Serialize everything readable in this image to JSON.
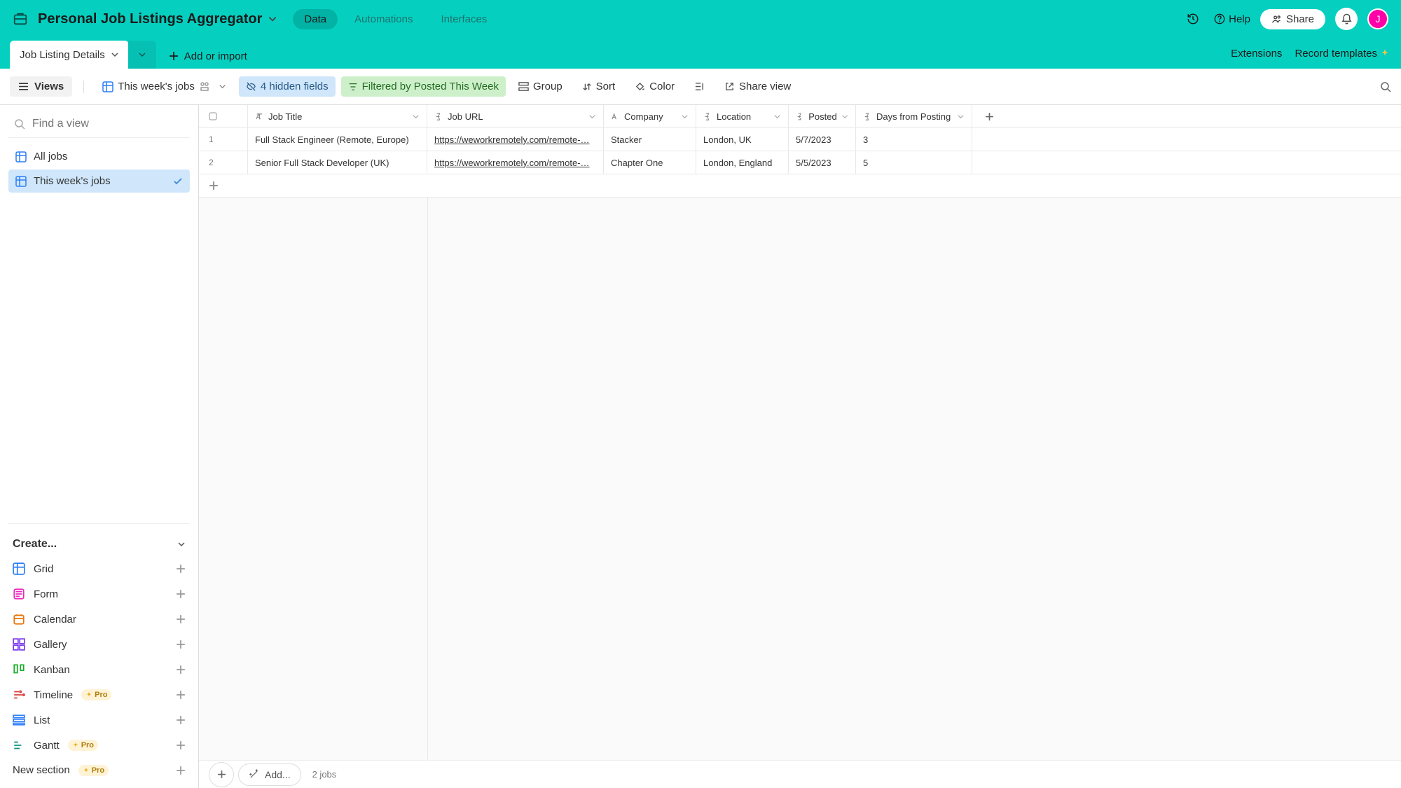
{
  "header": {
    "base_title": "Personal Job Listings Aggregator",
    "nav": {
      "data": "Data",
      "automations": "Automations",
      "interfaces": "Interfaces"
    },
    "help": "Help",
    "share": "Share",
    "avatar_initial": "J"
  },
  "tabbar": {
    "table_name": "Job Listing Details",
    "add_or_import": "Add or import",
    "extensions": "Extensions",
    "record_templates": "Record templates"
  },
  "toolbar": {
    "views": "Views",
    "view_name": "This week's jobs",
    "hidden_fields": "4 hidden fields",
    "filtered_by": "Filtered by Posted This Week",
    "group": "Group",
    "sort": "Sort",
    "color": "Color",
    "share_view": "Share view"
  },
  "sidebar": {
    "search_placeholder": "Find a view",
    "views": [
      {
        "label": "All jobs",
        "active": false
      },
      {
        "label": "This week's jobs",
        "active": true
      }
    ],
    "create_label": "Create...",
    "create_items": [
      {
        "label": "Grid",
        "icon": "grid",
        "color": "ic-blue",
        "pro": false
      },
      {
        "label": "Form",
        "icon": "form",
        "color": "ic-pink",
        "pro": false
      },
      {
        "label": "Calendar",
        "icon": "calendar",
        "color": "ic-orange",
        "pro": false
      },
      {
        "label": "Gallery",
        "icon": "gallery",
        "color": "ic-purple",
        "pro": false
      },
      {
        "label": "Kanban",
        "icon": "kanban",
        "color": "ic-green",
        "pro": false
      },
      {
        "label": "Timeline",
        "icon": "timeline",
        "color": "ic-red",
        "pro": true
      },
      {
        "label": "List",
        "icon": "list",
        "color": "ic-blue",
        "pro": false
      },
      {
        "label": "Gantt",
        "icon": "gantt",
        "color": "ic-teal",
        "pro": true
      }
    ],
    "new_section": "New section",
    "pro_label": "Pro"
  },
  "grid": {
    "columns": [
      {
        "key": "title",
        "label": "Job Title",
        "type": "text"
      },
      {
        "key": "url",
        "label": "Job URL",
        "type": "formula"
      },
      {
        "key": "company",
        "label": "Company",
        "type": "text"
      },
      {
        "key": "location",
        "label": "Location",
        "type": "formula"
      },
      {
        "key": "posted",
        "label": "Posted",
        "type": "formula"
      },
      {
        "key": "days",
        "label": "Days from Posting",
        "type": "formula"
      }
    ],
    "rows": [
      {
        "n": "1",
        "title": "Full Stack Engineer (Remote, Europe)",
        "url": "https://weworkremotely.com/remote-…",
        "company": "Stacker",
        "location": "London, UK",
        "posted": "5/7/2023",
        "days": "3"
      },
      {
        "n": "2",
        "title": "Senior Full Stack Developer (UK)",
        "url": "https://weworkremotely.com/remote-…",
        "company": "Chapter One",
        "location": "London, England",
        "posted": "5/5/2023",
        "days": "5"
      }
    ],
    "footer_add": "Add...",
    "footer_count": "2 jobs"
  }
}
